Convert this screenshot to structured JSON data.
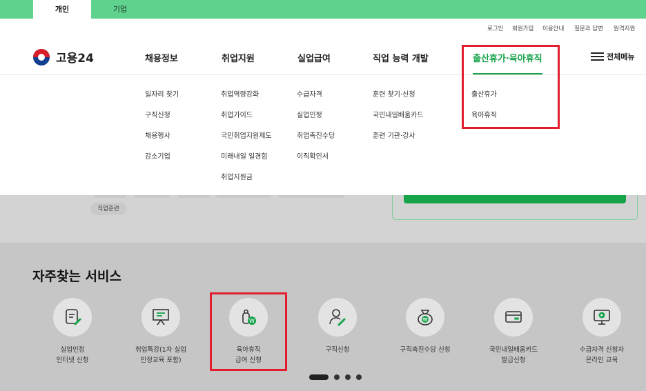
{
  "top_tabs": [
    {
      "label": "개인"
    },
    {
      "label": "기업"
    }
  ],
  "util_links": [
    "로그인",
    "회원가입",
    "이용안내",
    "질문과 답변",
    "원격지원"
  ],
  "logo_text": "고용24",
  "nav": [
    {
      "label": "채용정보",
      "sub": [
        "일자리 찾기",
        "구직신청",
        "채용행사",
        "강소기업"
      ]
    },
    {
      "label": "취업지원",
      "sub": [
        "취업역량강화",
        "취업가이드",
        "국민취업지원제도",
        "미래내일 일경험",
        "취업지원금"
      ]
    },
    {
      "label": "실업급여",
      "sub": [
        "수급자격",
        "실업인정",
        "취업촉진수당",
        "이직확인서"
      ]
    },
    {
      "label": "직업 능력 개발",
      "sub": [
        "훈련 찾기·신청",
        "국민내일배움카드",
        "훈련 기관·강사"
      ]
    },
    {
      "label": "출산휴가·육아휴직",
      "sub": [
        "출산휴가",
        "육아휴직"
      ]
    }
  ],
  "all_menu_label": "전체메뉴",
  "chip_label": "직업훈련",
  "services_title": "자주찾는 서비스",
  "services": [
    {
      "label": "실업인정\n인터넷 신청",
      "icon": "document-edit-icon"
    },
    {
      "label": "취업특강(1차 실업\n인정교육 포함)",
      "icon": "presentation-board-icon"
    },
    {
      "label": "육아휴직\n급여 신청",
      "icon": "baby-bottle-icon"
    },
    {
      "label": "구직신청",
      "icon": "person-edit-icon"
    },
    {
      "label": "구직촉진수당 신청",
      "icon": "money-bag-icon"
    },
    {
      "label": "국민내일배움카드\n발급신청",
      "icon": "credit-card-icon"
    },
    {
      "label": "수급자격 신청자\n온라인 교육",
      "icon": "monitor-play-icon"
    }
  ],
  "colors": {
    "brand_green": "#16a34a",
    "topbar_green": "#5fd28e",
    "highlight_red": "#e11d2e"
  }
}
